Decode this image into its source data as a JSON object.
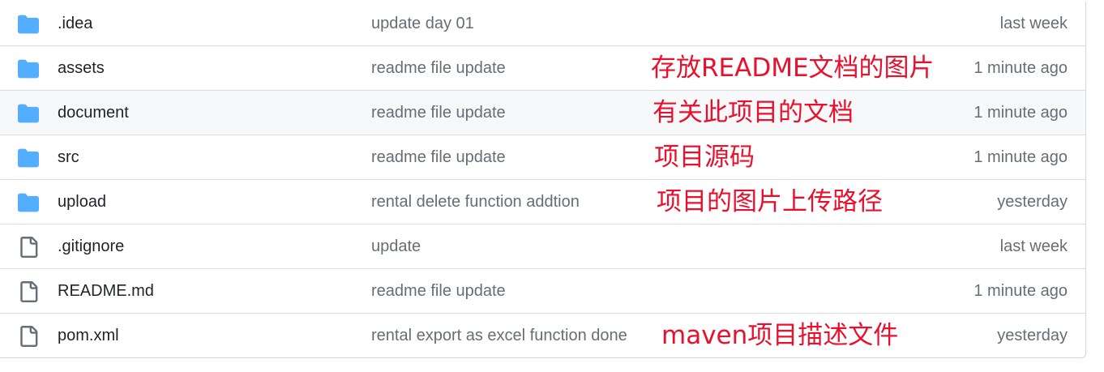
{
  "colors": {
    "folder": "#54aeff",
    "file_icon": "#656d76",
    "annotation": "#e8112d",
    "row_highlight": "#f6f8fa",
    "border": "#d0d7de"
  },
  "rows": [
    {
      "type": "folder",
      "icon": "folder-icon",
      "name": ".idea",
      "message": "update day 01",
      "time": "last week",
      "note": ""
    },
    {
      "type": "folder",
      "icon": "folder-icon",
      "name": "assets",
      "message": "readme file update",
      "time": "1 minute ago",
      "note": "存放README文档的图片"
    },
    {
      "type": "folder",
      "icon": "folder-icon",
      "name": "document",
      "message": "readme file update",
      "time": "1 minute ago",
      "note": "有关此项目的文档"
    },
    {
      "type": "folder",
      "icon": "folder-icon",
      "name": "src",
      "message": "readme file update",
      "time": "1 minute ago",
      "note": "项目源码"
    },
    {
      "type": "folder",
      "icon": "folder-icon",
      "name": "upload",
      "message": "rental delete function addtion",
      "time": "yesterday",
      "note": "项目的图片上传路径"
    },
    {
      "type": "file",
      "icon": "file-icon",
      "name": ".gitignore",
      "message": "update",
      "time": "last week",
      "note": ""
    },
    {
      "type": "file",
      "icon": "file-icon",
      "name": "README.md",
      "message": "readme file update",
      "time": "1 minute ago",
      "note": ""
    },
    {
      "type": "file",
      "icon": "file-icon",
      "name": "pom.xml",
      "message": "rental export as excel function done",
      "time": "yesterday",
      "note": "maven项目描述文件"
    }
  ]
}
